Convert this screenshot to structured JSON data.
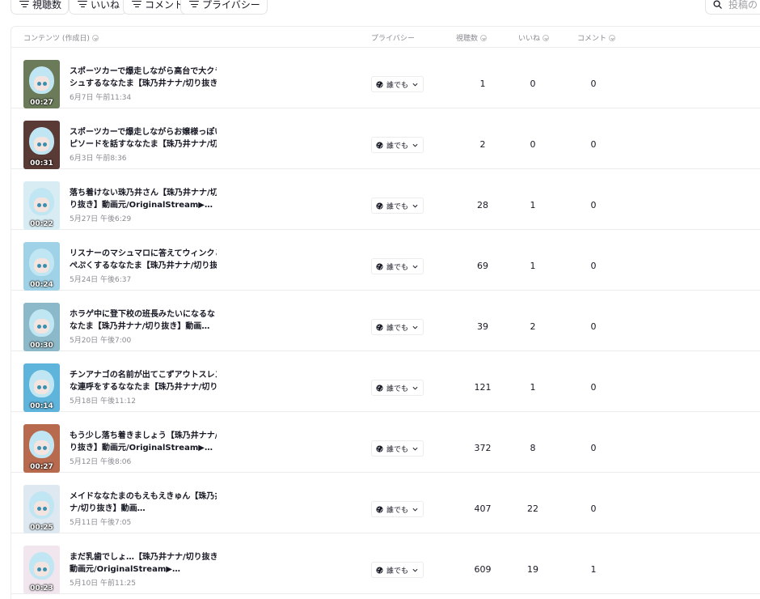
{
  "filters": [
    {
      "label": "視聴数",
      "left": 0
    },
    {
      "label": "いいね",
      "left": 0
    },
    {
      "label": "コメント",
      "left": 0
    },
    {
      "label": "プライバシー",
      "left": 0
    }
  ],
  "search": {
    "placeholder": "投稿の"
  },
  "headers": {
    "content": "コンテンツ (作成日)",
    "privacy": "プライバシー",
    "views": "視聴数",
    "likes": "いいね",
    "comments": "コメント"
  },
  "rows": [
    {
      "title1": "スポーツカーで爆走しながら高台で大クラッ",
      "title2": "シュするななたま【珠乃井ナナ/切り抜き】",
      "date": "6月7日 午前11:34",
      "duration": "00:27",
      "privacy": "誰でも",
      "views": "1",
      "likes": "0",
      "comments": "0",
      "bg": "#6b7b5a"
    },
    {
      "title1": "スポーツカーで爆走しながらお嬢様っぽいエ",
      "title2": "ピソードを話すななたま【珠乃井ナナ/切…",
      "date": "6月3日 午前8:36",
      "duration": "00:31",
      "privacy": "誰でも",
      "views": "2",
      "likes": "0",
      "comments": "0",
      "bg": "#5a3a35"
    },
    {
      "title1": "落ち着けない珠乃井さん【珠乃井ナナ/切",
      "title2": "り抜き】動画元/OriginalStream▶…",
      "date": "5月27日 午後6:29",
      "duration": "00:22",
      "privacy": "誰でも",
      "views": "28",
      "likes": "1",
      "comments": "0",
      "bg": "#d8ecf4"
    },
    {
      "title1": "リスナーのマシュマロに答えてウィンクとほっ",
      "title2": "ぺぷくするななたま【珠乃井ナナ/切り抜…",
      "date": "5月24日 午後6:37",
      "duration": "00:24",
      "privacy": "誰でも",
      "views": "69",
      "likes": "1",
      "comments": "0",
      "bg": "#9fd2e6"
    },
    {
      "title1": "ホラゲ中に登下校の班長みたいになるな",
      "title2": "なたま【珠乃井ナナ/切り抜き】動画…",
      "date": "5月20日 午後7:00",
      "duration": "00:30",
      "privacy": "誰でも",
      "views": "39",
      "likes": "2",
      "comments": "0",
      "bg": "#8cb9c9"
    },
    {
      "title1": "チンアナゴの名前が出てこずアウトスレスレ",
      "title2": "な連呼をするななたま【珠乃井ナナ/切り…",
      "date": "5月18日 午後11:12",
      "duration": "00:14",
      "privacy": "誰でも",
      "views": "121",
      "likes": "1",
      "comments": "0",
      "bg": "#5fb4dc"
    },
    {
      "title1": "もう少し落ち着きましょう【珠乃井ナナ/切",
      "title2": "り抜き】動画元/OriginalStream▶…",
      "date": "5月12日 午後8:06",
      "duration": "00:27",
      "privacy": "誰でも",
      "views": "372",
      "likes": "8",
      "comments": "0",
      "bg": "#b86a4f"
    },
    {
      "title1": "メイドななたまのもえもえきゅん【珠乃井ナ",
      "title2": "ナ/切り抜き】動画…",
      "date": "5月11日 午後7:05",
      "duration": "00:25",
      "privacy": "誰でも",
      "views": "407",
      "likes": "22",
      "comments": "0",
      "bg": "#dde8f0"
    },
    {
      "title1": "まだ乳歯でしょ…【珠乃井ナナ/切り抜き】",
      "title2": "動画元/OriginalStream▶…",
      "date": "5月10日 午前11:25",
      "duration": "00:23",
      "privacy": "誰でも",
      "views": "609",
      "likes": "19",
      "comments": "1",
      "bg": "#f1e6ee"
    }
  ]
}
